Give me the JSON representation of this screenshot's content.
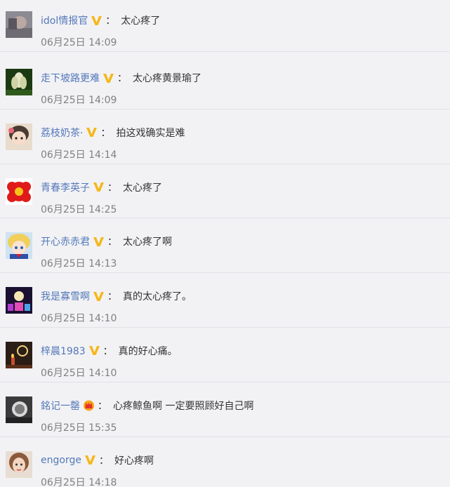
{
  "comments": [
    {
      "user": "idol情报官",
      "badge": "v-badge",
      "text": "太心疼了",
      "time": "06月25日 14:09"
    },
    {
      "user": "走下坡路更难",
      "badge": "v-badge",
      "text": "太心疼黄景瑜了",
      "time": "06月25日 14:09"
    },
    {
      "user": "荔枝奶茶·",
      "badge": "v-badge",
      "text": "拍这戏确实是难",
      "time": "06月25日 14:14"
    },
    {
      "user": "青春李英子",
      "badge": "v-badge",
      "text": "太心疼了",
      "time": "06月25日 14:25"
    },
    {
      "user": "开心赤赤君",
      "badge": "v-badge",
      "text": "太心疼了啊",
      "time": "06月25日 14:13"
    },
    {
      "user": "我是寡雪啊",
      "badge": "v-badge",
      "text": "真的太心疼了。",
      "time": "06月25日 14:10"
    },
    {
      "user": "梓晨1983",
      "badge": "v-badge",
      "text": "真的好心痛。",
      "time": "06月25日 14:10"
    },
    {
      "user": "銘记一罄",
      "badge": "crown-badge",
      "text": "心疼鲸鱼啊 一定要照顾好自己啊",
      "time": "06月25日 15:35"
    },
    {
      "user": "engorge",
      "badge": "v-badge",
      "text": "好心疼啊",
      "time": "06月25日 14:18"
    }
  ],
  "colon": "："
}
